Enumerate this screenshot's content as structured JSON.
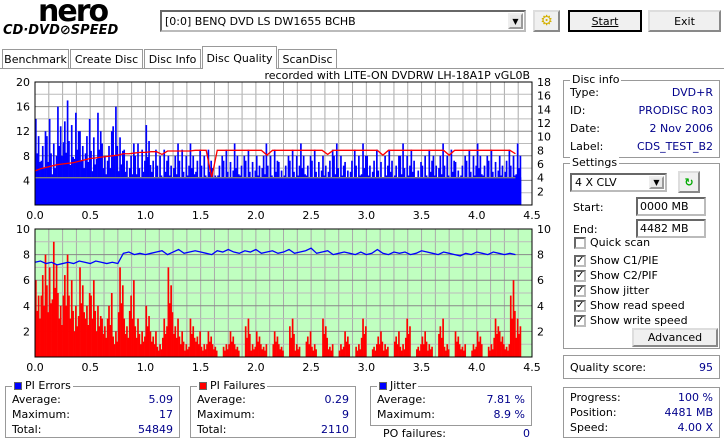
{
  "app": {
    "logo_top": "nero",
    "logo_bottom": "CD·DVD⊘SPEED"
  },
  "toolbar": {
    "drive": "[0:0]  BENQ DVD LS DW1655 BCHB",
    "start_label": "Start",
    "exit_label": "Exit"
  },
  "tabs": [
    {
      "label": "Benchmark"
    },
    {
      "label": "Create Disc"
    },
    {
      "label": "Disc Info"
    },
    {
      "label": "Disc Quality",
      "selected": true
    },
    {
      "label": "ScanDisc"
    }
  ],
  "chart_caption": "recorded with LITE-ON DVDRW LH-18A1P   vGL0B",
  "disc_info": {
    "title": "Disc info",
    "rows": [
      {
        "label": "Type:",
        "value": "DVD+R"
      },
      {
        "label": "ID:",
        "value": "PRODISC R03"
      },
      {
        "label": "Date:",
        "value": "2 Nov 2006"
      },
      {
        "label": "Label:",
        "value": "CDS_TEST_B2"
      }
    ]
  },
  "settings": {
    "title": "Settings",
    "speed": "4 X CLV",
    "start_label": "Start:",
    "start_value": "0000 MB",
    "end_label": "End:",
    "end_value": "4482 MB",
    "checks": [
      {
        "label": "Quick scan",
        "checked": false
      },
      {
        "label": "Show C1/PIE",
        "checked": true
      },
      {
        "label": "Show C2/PIF",
        "checked": true
      },
      {
        "label": "Show jitter",
        "checked": true
      },
      {
        "label": "Show read speed",
        "checked": true
      },
      {
        "label": "Show write speed",
        "checked": true
      }
    ],
    "advanced_label": "Advanced"
  },
  "quality": {
    "label": "Quality score:",
    "value": "95"
  },
  "progress": {
    "rows": [
      {
        "label": "Progress:",
        "value": "100 %"
      },
      {
        "label": "Position:",
        "value": "4481 MB"
      },
      {
        "label": "Speed:",
        "value": "4.00 X"
      }
    ]
  },
  "pi_errors": {
    "title": "PI Errors",
    "color": "#0000ff",
    "rows": [
      {
        "label": "Average:",
        "value": "5.09"
      },
      {
        "label": "Maximum:",
        "value": "17"
      },
      {
        "label": "Total:",
        "value": "54849"
      }
    ]
  },
  "pi_failures": {
    "title": "PI Failures",
    "color": "#ff0000",
    "rows": [
      {
        "label": "Average:",
        "value": "0.29"
      },
      {
        "label": "Maximum:",
        "value": "9"
      },
      {
        "label": "Total:",
        "value": "2110"
      }
    ]
  },
  "jitter": {
    "title": "Jitter",
    "color": "#0000ff",
    "rows": [
      {
        "label": "Average:",
        "value": "7.81 %"
      },
      {
        "label": "Maximum:",
        "value": "8.9 %"
      }
    ]
  },
  "po_failures": {
    "label": "PO failures:",
    "value": "0"
  },
  "chart_data": [
    {
      "type": "bar",
      "title": "PI Errors / speed",
      "x_step": 0.05,
      "xlim": [
        0,
        4.5
      ],
      "x_ticks": [
        "0.0",
        "0.5",
        "1.0",
        "1.5",
        "2.0",
        "2.5",
        "3.0",
        "3.5",
        "4.0",
        "4.5"
      ],
      "ylim": [
        0,
        20
      ],
      "y_ticks": [
        "4",
        "8",
        "12",
        "16",
        "20"
      ],
      "y2lim": [
        0,
        18
      ],
      "y2_ticks": [
        "2",
        "4",
        "6",
        "8",
        "10",
        "12",
        "14",
        "16",
        "18"
      ],
      "series": [
        {
          "name": "PIE",
          "color": "#0000ff",
          "values": [
            14,
            12,
            14,
            10,
            16,
            17,
            13,
            15,
            12,
            14,
            11,
            15,
            10,
            12,
            16,
            11,
            9,
            10,
            10,
            9,
            13,
            9,
            8,
            9,
            8,
            10,
            9,
            8,
            10,
            9,
            8,
            9,
            6,
            8,
            9,
            7,
            10,
            8,
            9,
            7,
            8,
            10,
            8,
            9,
            7,
            8,
            9,
            8,
            10,
            8,
            9,
            7,
            8,
            9,
            10,
            8,
            7,
            9,
            8,
            10,
            8,
            9,
            7,
            8,
            9,
            8,
            10,
            8,
            9,
            7,
            8,
            9,
            8,
            10,
            8,
            9,
            7,
            8,
            9,
            8,
            10,
            8,
            9,
            7,
            8,
            9,
            8,
            10
          ]
        },
        {
          "name": "Read speed",
          "axis": "right",
          "color": "#ff0000",
          "values": [
            5.0,
            5.3,
            5.5,
            5.7,
            5.9,
            6.0,
            6.1,
            6.2,
            6.4,
            6.6,
            6.8,
            6.9,
            7.0,
            7.1,
            7.2,
            7.3,
            7.5,
            7.5,
            7.6,
            7.7,
            7.7,
            7.8,
            7.8,
            7.4,
            7.9,
            7.9,
            7.9,
            7.9,
            7.9,
            8.0,
            8.0,
            8.0,
            4.0,
            8.0,
            8.0,
            8.0,
            8.0,
            8.0,
            8.0,
            8.0,
            8.0,
            8.0,
            7.3,
            8.0,
            8.0,
            8.0,
            8.0,
            8.0,
            8.0,
            8.0,
            8.0,
            8.0,
            8.0,
            7.4,
            8.0,
            8.0,
            8.0,
            8.0,
            8.0,
            8.0,
            8.0,
            8.0,
            8.0,
            7.3,
            8.0,
            8.0,
            8.0,
            8.0,
            8.0,
            8.0,
            8.0,
            8.0,
            8.0,
            8.0,
            8.0,
            7.3,
            8.0,
            8.0,
            8.0,
            8.0,
            8.0,
            8.0,
            8.0,
            8.0,
            8.0,
            8.0,
            8.0,
            7.5
          ]
        },
        {
          "name": "Write speed",
          "axis": "right",
          "color": "#808080",
          "values": [
            4,
            4,
            4,
            4,
            4,
            4,
            4,
            4,
            4,
            4,
            4,
            4,
            4,
            4,
            4,
            4,
            4,
            4,
            4,
            4,
            4,
            4,
            4,
            4,
            4,
            4,
            4,
            4,
            4,
            4,
            4,
            4,
            4,
            4,
            4,
            4,
            4,
            4,
            4,
            4,
            4,
            4,
            4,
            4,
            4,
            4,
            4,
            4,
            4,
            4,
            4,
            4,
            4,
            4,
            4,
            4,
            4,
            4,
            4,
            4,
            4,
            4,
            4,
            4,
            4,
            4,
            4,
            4,
            4,
            4,
            4,
            4,
            4,
            4,
            4,
            4,
            4,
            4,
            4,
            4,
            4,
            4,
            4,
            4,
            4,
            4,
            4,
            4
          ]
        }
      ]
    },
    {
      "type": "bar",
      "title": "PI Failures / jitter",
      "x_step": 0.05,
      "xlim": [
        0,
        4.5
      ],
      "x_ticks": [
        "0.0",
        "0.5",
        "1.0",
        "1.5",
        "2.0",
        "2.5",
        "3.0",
        "3.5",
        "4.0",
        "4.5"
      ],
      "ylim": [
        0,
        10
      ],
      "y_ticks": [
        "2",
        "4",
        "6",
        "8",
        "10"
      ],
      "y2lim": [
        0,
        10
      ],
      "y2_ticks": [
        "2",
        "4",
        "6",
        "8",
        "10"
      ],
      "series": [
        {
          "name": "PIF",
          "color": "#ff0000",
          "values": [
            6,
            8,
            7,
            9,
            5,
            8,
            6,
            4,
            7,
            5,
            6,
            4,
            3,
            5,
            2,
            7,
            3,
            6,
            3,
            2,
            4,
            2,
            1,
            3,
            7,
            3,
            2,
            1,
            3,
            2,
            1,
            2,
            1,
            0,
            1,
            2,
            1,
            0,
            3,
            1,
            2,
            1,
            0,
            2,
            1,
            0,
            3,
            1,
            0,
            2,
            1,
            0,
            3,
            1,
            0,
            1,
            2,
            0,
            1,
            3,
            0,
            1,
            2,
            1,
            0,
            2,
            1,
            3,
            0,
            1,
            2,
            1,
            0,
            3,
            1,
            0,
            2,
            1,
            0,
            1,
            2,
            0,
            1,
            3,
            2,
            1,
            6,
            3
          ]
        },
        {
          "name": "Jitter",
          "axis": "right",
          "color": "#0000ff",
          "values": [
            7.4,
            7.5,
            7.3,
            7.4,
            7.2,
            7.3,
            7.4,
            7.3,
            7.5,
            7.4,
            7.3,
            7.5,
            7.4,
            7.3,
            7.4,
            7.3,
            8.1,
            8.2,
            8.0,
            8.1,
            8.0,
            8.1,
            8.2,
            8.3,
            8.0,
            8.2,
            8.4,
            8.1,
            8.2,
            8.3,
            8.2,
            8.1,
            8.0,
            8.3,
            8.2,
            8.4,
            8.2,
            8.1,
            8.3,
            8.2,
            8.4,
            8.1,
            8.2,
            8.3,
            8.1,
            8.2,
            8.4,
            8.1,
            8.2,
            8.3,
            8.5,
            8.1,
            8.2,
            8.3,
            8.0,
            8.1,
            8.2,
            8.1,
            8.0,
            8.2,
            8.0,
            8.1,
            8.4,
            8.1,
            8.0,
            8.2,
            8.1,
            8.2,
            8.0,
            8.1,
            8.3,
            8.2,
            8.1,
            8.0,
            8.2,
            8.1,
            8.0,
            7.9,
            8.1,
            8.0,
            8.2,
            8.1,
            8.0,
            8.2,
            8.1,
            8.0,
            8.1,
            8.0
          ]
        }
      ]
    }
  ]
}
